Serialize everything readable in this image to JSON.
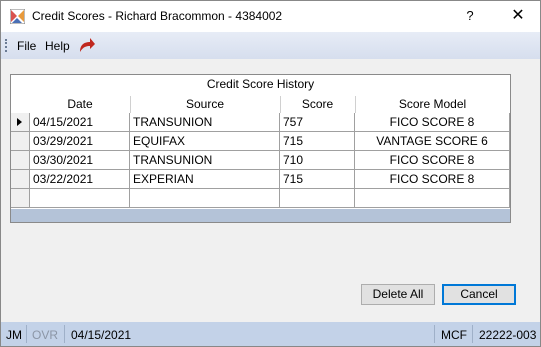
{
  "window": {
    "title": "Credit Scores - Richard Bracommon - 4384002",
    "help_label": "?",
    "close_label": "✕"
  },
  "menu": {
    "file_label": "File",
    "help_label": "Help"
  },
  "grid": {
    "caption": "Credit Score History",
    "columns": [
      "Date",
      "Source",
      "Score",
      "Score Model"
    ],
    "rows": [
      {
        "date": "04/15/2021",
        "source": "TRANSUNION",
        "score": "757",
        "model": "FICO SCORE 8"
      },
      {
        "date": "03/29/2021",
        "source": "EQUIFAX",
        "score": "715",
        "model": "VANTAGE SCORE 6"
      },
      {
        "date": "03/30/2021",
        "source": "TRANSUNION",
        "score": "710",
        "model": "FICO SCORE 8"
      },
      {
        "date": "03/22/2021",
        "source": "EXPERIAN",
        "score": "715",
        "model": "FICO SCORE 8"
      }
    ]
  },
  "buttons": {
    "delete_all": "Delete All",
    "cancel": "Cancel"
  },
  "status": {
    "user": "JM",
    "ovr": "OVR",
    "date": "04/15/2021",
    "mcf": "MCF",
    "code": "22222-003"
  },
  "colors": {
    "menubar": "#d6deee",
    "statusbar": "#c3d2e8",
    "grid_footer": "#b4c3d8",
    "default_button_border": "#0078d7"
  }
}
